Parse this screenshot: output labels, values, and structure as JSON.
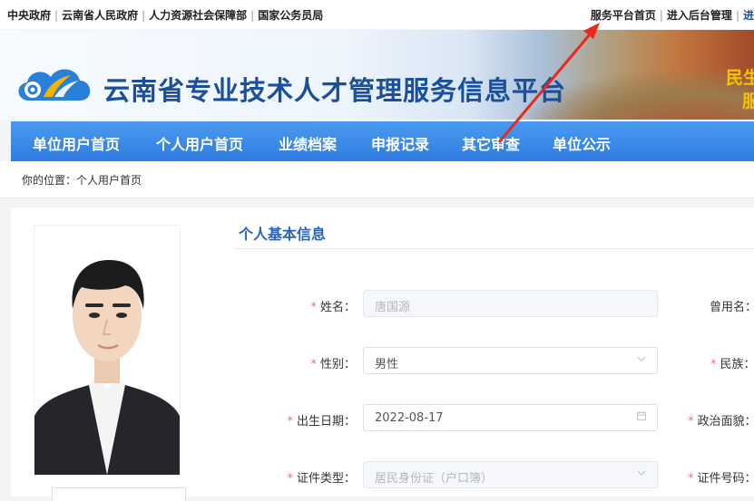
{
  "topbar": {
    "left_links": [
      "中央政府",
      "云南省人民政府",
      "人力资源社会保障部",
      "国家公务员局"
    ],
    "right_links": [
      "服务平台首页",
      "进入后台管理"
    ]
  },
  "banner": {
    "title": "云南省专业技术人才管理服务信息平台",
    "slogan_line1": "民生",
    "slogan_line2": "服"
  },
  "nav": {
    "items": [
      "单位用户首页",
      "个人用户首页",
      "业绩档案",
      "申报记录",
      "其它审查",
      "单位公示"
    ]
  },
  "breadcrumb": {
    "text": "你的位置：个人用户首页"
  },
  "section": {
    "title": "个人基本信息"
  },
  "form": {
    "name_label": "姓名：",
    "name_value": "唐国源",
    "gender_label": "性别：",
    "gender_value": "男性",
    "birth_label": "出生日期：",
    "birth_value": "2022-08-17",
    "idtype_label": "证件类型：",
    "idtype_value": "居民身份证（户口簿）",
    "former_name_label": "曾用名：",
    "ethnicity_label": "民族：",
    "political_label": "政治面貌：",
    "idnum_label": "证件号码："
  },
  "icons": {
    "select": "chevron-down-icon",
    "date": "calendar-icon"
  },
  "colors": {
    "nav_blue": "#2f7ce0",
    "title_blue": "#1a4f9c",
    "required": "#f56c6c",
    "annotation_arrow": "#e8291c"
  }
}
